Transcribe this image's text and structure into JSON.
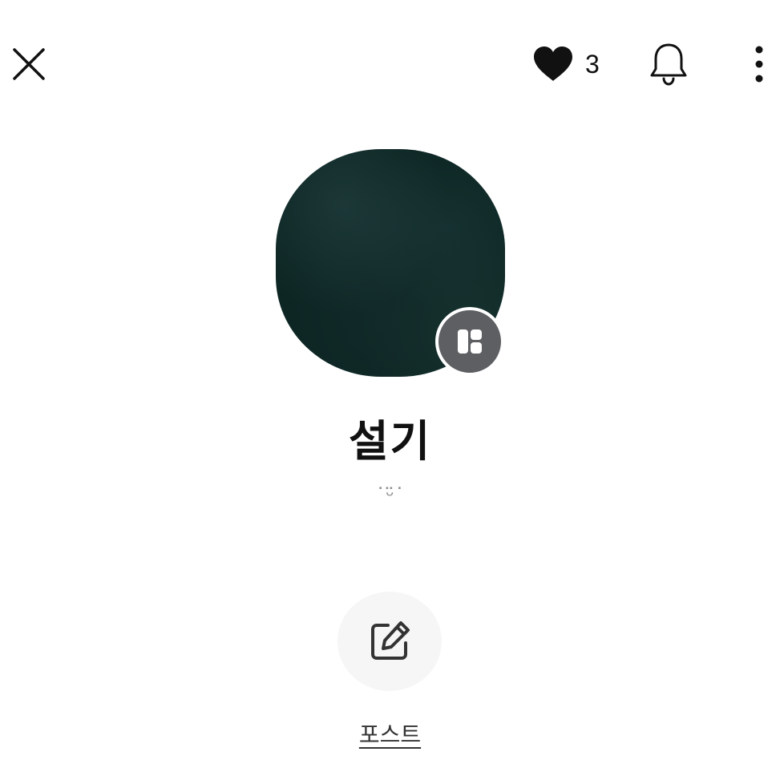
{
  "header": {
    "close_icon": "close-icon",
    "like_icon": "heart-icon",
    "like_count": "3",
    "bell_icon": "bell-icon",
    "more_icon": "more-vertical-icon"
  },
  "profile": {
    "name": "설기",
    "status": "˙ᵕ̈˙",
    "badge_icon": "layout-icon",
    "image_color": "#0d2624"
  },
  "actions": {
    "post_icon": "edit-icon",
    "post_label": "포스트"
  }
}
